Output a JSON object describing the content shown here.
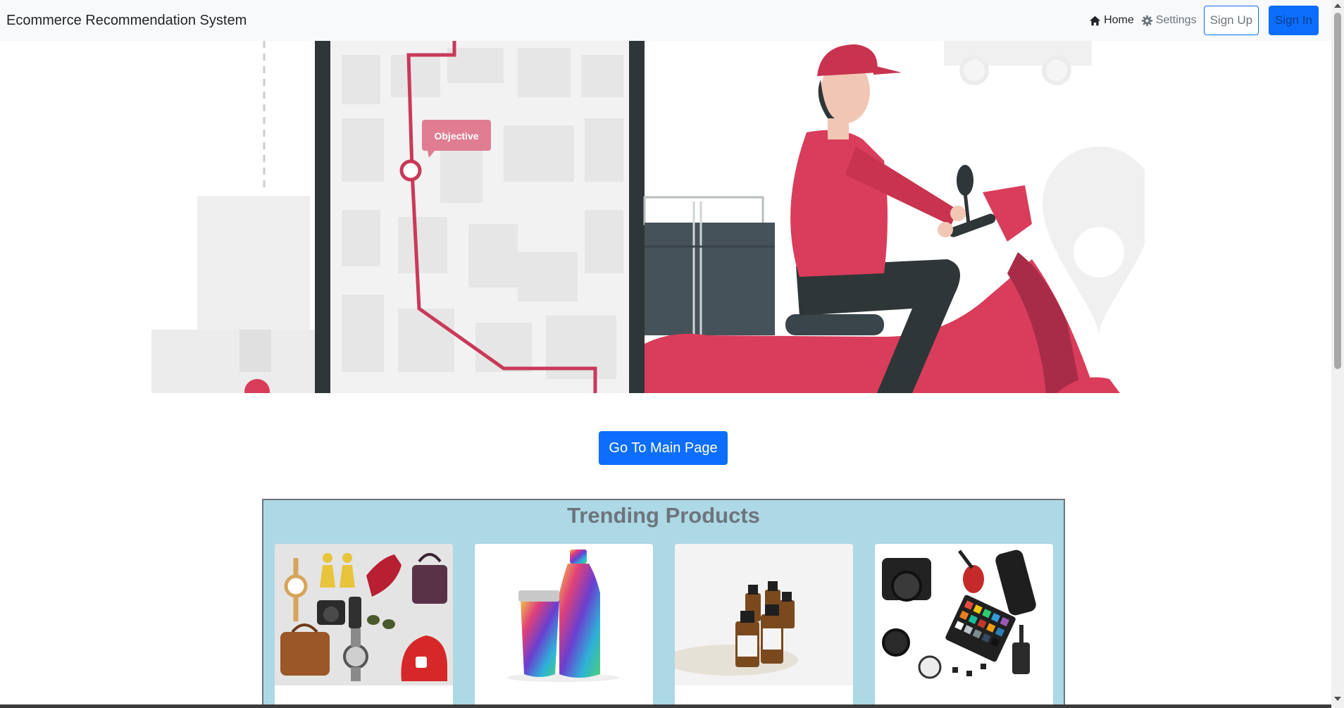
{
  "navbar": {
    "brand": "Ecommerce Recommendation System",
    "home_label": "Home",
    "settings_label": "Settings",
    "signup_label": "Sign Up",
    "signin_label": "Sign In"
  },
  "hero": {
    "map_callout": "Objective"
  },
  "main_button_label": "Go To Main Page",
  "trending": {
    "title": "Trending Products"
  },
  "colors": {
    "primary": "#0d6efd",
    "trending_bg": "#add8e6",
    "navbar_bg": "#f8f9fa",
    "rider_red": "#d93d5b"
  },
  "icons": {
    "home": "home-icon",
    "settings": "gear-icon"
  }
}
